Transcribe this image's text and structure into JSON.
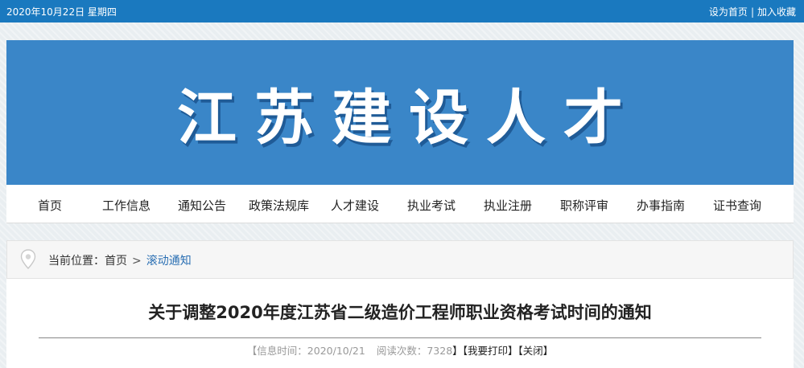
{
  "topbar": {
    "date": "2020年10月22日 星期四",
    "set_home": "设为首页",
    "separator": "|",
    "bookmark": "加入收藏"
  },
  "banner": {
    "brand": "江苏建设人才"
  },
  "nav": {
    "items": [
      "首页",
      "工作信息",
      "通知公告",
      "政策法规库",
      "人才建设",
      "执业考试",
      "执业注册",
      "职称评审",
      "办事指南",
      "证书查询"
    ]
  },
  "breadcrumb": {
    "label": "当前位置：",
    "home": "首页",
    "separator": ">",
    "current": "滚动通知"
  },
  "article": {
    "title": "关于调整2020年度江苏省二级造价工程师职业资格考试时间的通知",
    "time_label": "【信息时间：",
    "time_value": "2020/10/21",
    "views_label": "阅读次数：",
    "views_value": "7328",
    "views_close": "】",
    "print_label": "【我要打印】",
    "close_label": "【关闭】"
  },
  "colors": {
    "topbar": "#1a79bf",
    "banner": "#3a86c8",
    "link": "#2a6fb3"
  }
}
